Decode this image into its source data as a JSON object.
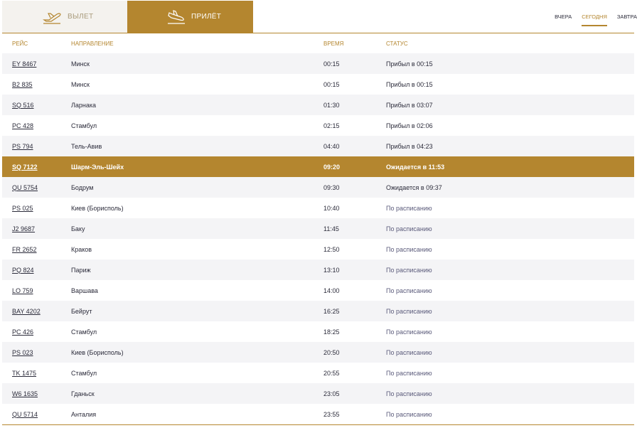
{
  "tabs": {
    "departures": {
      "label": "ВЫЛЕТ",
      "icon": "plane-takeoff-icon"
    },
    "arrivals": {
      "label": "ПРИЛЁТ",
      "icon": "plane-landing-icon"
    }
  },
  "days": [
    {
      "label": "ВЧЕРА",
      "active": false
    },
    {
      "label": "СЕГОДНЯ",
      "active": true
    },
    {
      "label": "ЗАВТРА",
      "active": false
    }
  ],
  "columns": {
    "flight": "РЕЙС",
    "direction": "НАПРАВЛЕНИЕ",
    "time": "ВРЕМЯ",
    "status": "СТАТУС"
  },
  "colors": {
    "accent": "#b4862f",
    "row_alt": "#f4f4f6",
    "text": "#2b2b3a"
  },
  "flights": [
    {
      "flight": "EY 8467",
      "direction": "Минск",
      "time": "00:15",
      "status": "Прибыл в 00:15",
      "type": "arrived"
    },
    {
      "flight": "B2 835",
      "direction": "Минск",
      "time": "00:15",
      "status": "Прибыл в 00:15",
      "type": "arrived"
    },
    {
      "flight": "SQ 516",
      "direction": "Ларнака",
      "time": "01:30",
      "status": "Прибыл в 03:07",
      "type": "arrived"
    },
    {
      "flight": "PC 428",
      "direction": "Стамбул",
      "time": "02:15",
      "status": "Прибыл в 02:06",
      "type": "arrived"
    },
    {
      "flight": "PS 794",
      "direction": "Тель-Авив",
      "time": "04:40",
      "status": "Прибыл в 04:23",
      "type": "arrived"
    },
    {
      "flight": "SQ 7122",
      "direction": "Шарм-Эль-Шейх",
      "time": "09:20",
      "status": "Ожидается в 11:53",
      "type": "highlight"
    },
    {
      "flight": "QU 5754",
      "direction": "Бодрум",
      "time": "09:30",
      "status": "Ожидается в 09:37",
      "type": "expected"
    },
    {
      "flight": "PS 025",
      "direction": "Киев (Борисполь)",
      "time": "10:40",
      "status": "По расписанию",
      "type": "scheduled"
    },
    {
      "flight": "J2 9687",
      "direction": "Баку",
      "time": "11:45",
      "status": "По расписанию",
      "type": "scheduled"
    },
    {
      "flight": "FR 2652",
      "direction": "Краков",
      "time": "12:50",
      "status": "По расписанию",
      "type": "scheduled"
    },
    {
      "flight": "PQ 824",
      "direction": "Париж",
      "time": "13:10",
      "status": "По расписанию",
      "type": "scheduled"
    },
    {
      "flight": "LO 759",
      "direction": "Варшава",
      "time": "14:00",
      "status": "По расписанию",
      "type": "scheduled"
    },
    {
      "flight": "BAY 4202",
      "direction": "Бейрут",
      "time": "16:25",
      "status": "По расписанию",
      "type": "scheduled"
    },
    {
      "flight": "PC 426",
      "direction": "Стамбул",
      "time": "18:25",
      "status": "По расписанию",
      "type": "scheduled"
    },
    {
      "flight": "PS 023",
      "direction": "Киев (Борисполь)",
      "time": "20:50",
      "status": "По расписанию",
      "type": "scheduled"
    },
    {
      "flight": "TK 1475",
      "direction": "Стамбул",
      "time": "20:55",
      "status": "По расписанию",
      "type": "scheduled"
    },
    {
      "flight": "W6 1635",
      "direction": "Гданьск",
      "time": "23:05",
      "status": "По расписанию",
      "type": "scheduled"
    },
    {
      "flight": "QU 5714",
      "direction": "Анталия",
      "time": "23:55",
      "status": "По расписанию",
      "type": "scheduled"
    }
  ]
}
